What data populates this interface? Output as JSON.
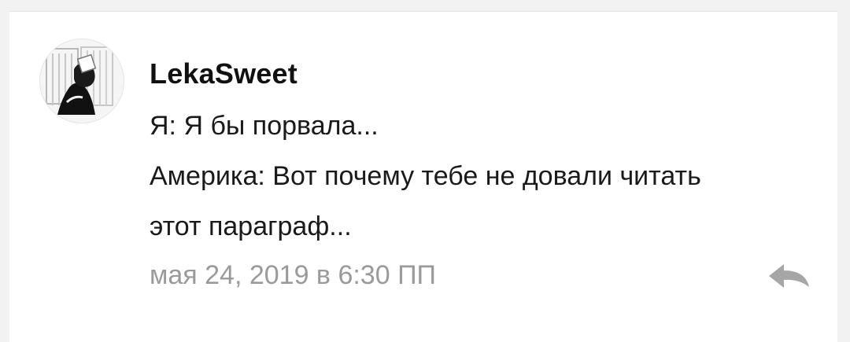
{
  "comment": {
    "author": "LekaSweet",
    "lines": [
      "Я: Я бы порвала...",
      "Америка: Вот почему тебе не довали читать",
      "этот параграф..."
    ],
    "timestamp": "мая 24, 2019 в 6:30 ПП",
    "avatar_icon": "avatar-icon",
    "reply_icon": "reply-icon"
  },
  "colors": {
    "text": "#1a1a1a",
    "muted": "#9a9a9a",
    "background": "#ffffff",
    "page": "#f2f2f2"
  }
}
